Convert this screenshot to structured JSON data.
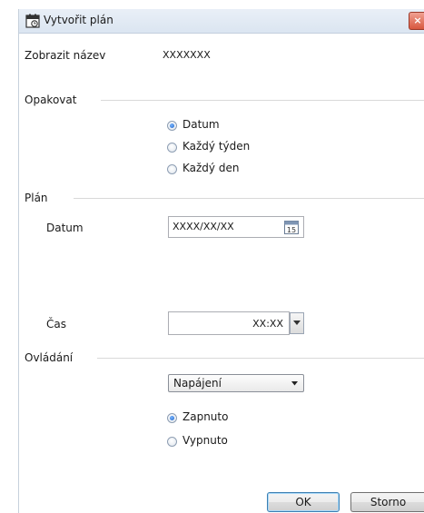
{
  "window": {
    "title": "Vytvořit plán"
  },
  "display_name": {
    "label": "Zobrazit název",
    "value": "XXXXXXX"
  },
  "repeat": {
    "header": "Opakovat",
    "options": [
      {
        "label": "Datum",
        "selected": true
      },
      {
        "label": "Každý týden",
        "selected": false
      },
      {
        "label": "Každý den",
        "selected": false
      }
    ]
  },
  "plan": {
    "header": "Plán",
    "date_label": "Datum",
    "date_value": "XXXX/XX/XX",
    "calendar_day": "15",
    "time_label": "Čas",
    "time_value": "XX:XX"
  },
  "control": {
    "header": "Ovládání",
    "dropdown_value": "Napájení",
    "options": [
      {
        "label": "Zapnuto",
        "selected": true
      },
      {
        "label": "Vypnuto",
        "selected": false
      }
    ]
  },
  "buttons": {
    "ok": "OK",
    "cancel": "Storno"
  },
  "colors": {
    "selected_radio": "#1d63c7",
    "titlebar": "#dbe5f1",
    "close_button": "#d8573f"
  }
}
